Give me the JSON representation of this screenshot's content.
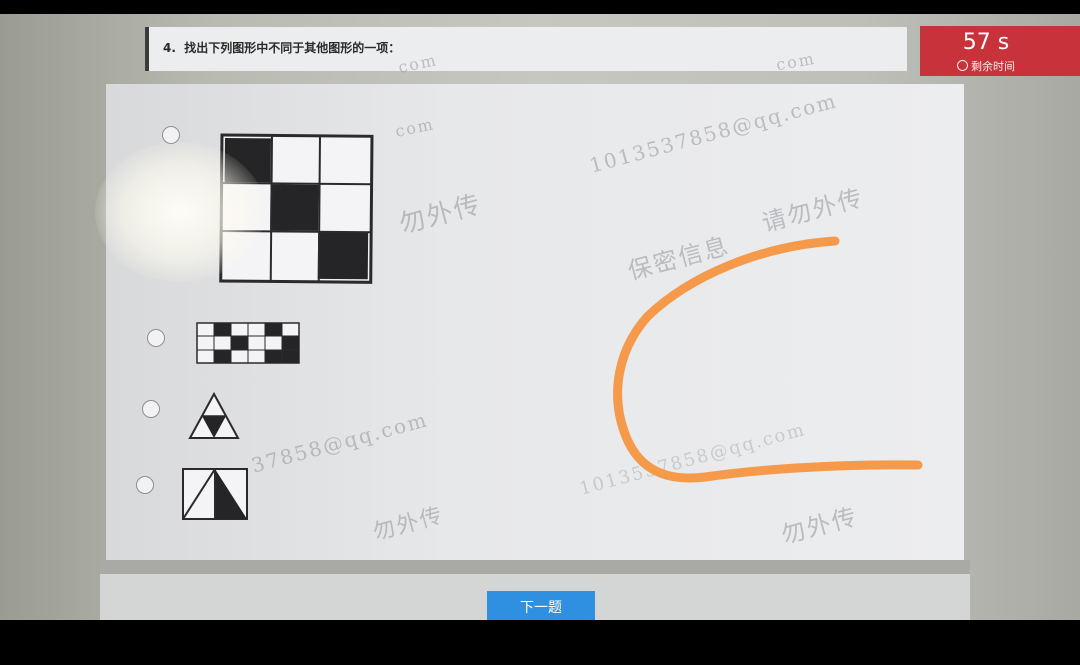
{
  "question": {
    "number": "4.",
    "text": "找出下列图形中不同于其他图形的一项："
  },
  "timer": {
    "value": "57 s",
    "caption": "剩余时间"
  },
  "options": [
    {
      "id": "option-a",
      "figure": "3x3 grid with diagonal dark cells"
    },
    {
      "id": "option-b",
      "figure": "small 6x3 grid"
    },
    {
      "id": "option-c",
      "figure": "triangle with inverted dark triangle"
    },
    {
      "id": "option-d",
      "figure": "square with diagonal and dark triangle"
    }
  ],
  "watermarks": {
    "w1": "com",
    "w2": "com",
    "w3": "com",
    "w4": "1013537858@qq.com",
    "w5": "勿外传",
    "w6": "保密信息",
    "w7": "请勿外传",
    "w8": "37858@qq.com",
    "w9": "勿外传",
    "w10": "1013537858@qq.com",
    "w11": "勿外传"
  },
  "next_button_label": "下一题",
  "colors": {
    "timer_bg": "#c8323a",
    "button_bg": "#2f8fe0",
    "annotation_stroke": "#f59a4a"
  }
}
